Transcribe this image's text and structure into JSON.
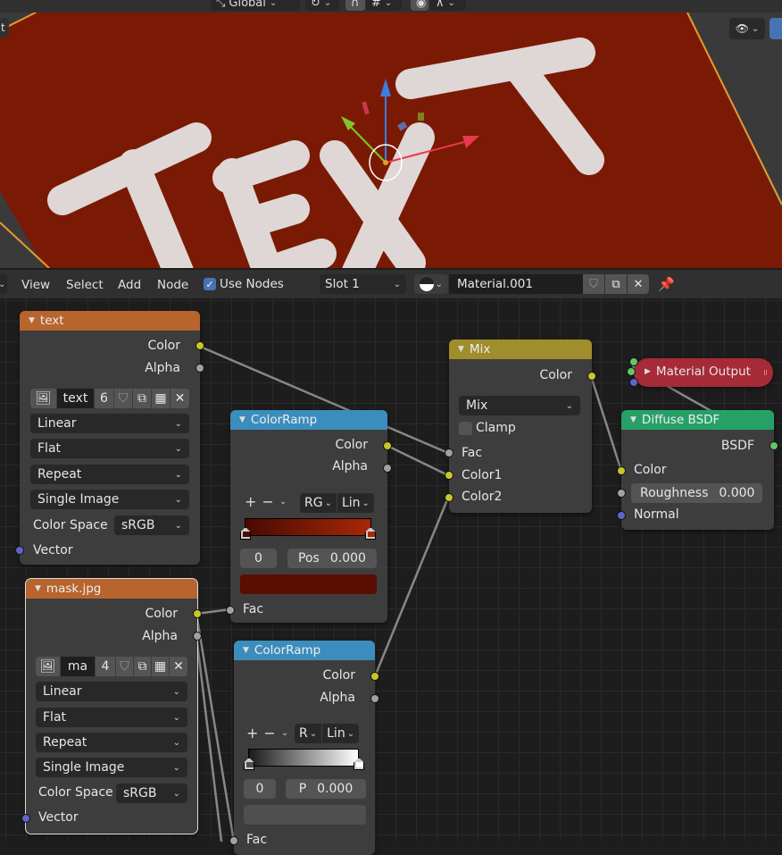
{
  "viewport": {
    "header": {
      "orientation": "Global",
      "orientation_icon": "transform-orientation-icon",
      "pivot_icon": "pivot-point-icon",
      "snap_icon": "snap-magnet-icon",
      "snap_target_icon": "snap-increment-icon",
      "proportional_icon": "proportional-edit-icon",
      "falloff_icon": "falloff-curve-icon"
    },
    "left_tab": "t",
    "scene_text": "TEXT",
    "visibility_icon": "eye-selectability-icon",
    "gizmo_icon": "gizmo-toggle-icon",
    "colors": {
      "plane": "#7a1a05",
      "plane_edge": "#e89a2c",
      "text": "#e8e8e8"
    }
  },
  "node_header": {
    "menus": [
      "View",
      "Select",
      "Add",
      "Node"
    ],
    "use_nodes_label": "Use Nodes",
    "use_nodes_checked": true,
    "slot": "Slot 1",
    "material_name": "Material.001",
    "pin_icon": "pin-icon"
  },
  "nodes": {
    "image_text": {
      "title": "text",
      "outputs": [
        "Color",
        "Alpha"
      ],
      "image_name": "text",
      "users": "6",
      "interpolation": "Linear",
      "projection": "Flat",
      "extension": "Repeat",
      "source": "Single Image",
      "color_space_label": "Color Space",
      "color_space": "sRGB",
      "input": "Vector"
    },
    "image_mask": {
      "title": "mask.jpg",
      "outputs": [
        "Color",
        "Alpha"
      ],
      "image_name": "ma",
      "users": "4",
      "interpolation": "Linear",
      "projection": "Flat",
      "extension": "Repeat",
      "source": "Single Image",
      "color_space_label": "Color Space",
      "color_space": "sRGB",
      "input": "Vector"
    },
    "colorramp_1": {
      "title": "ColorRamp",
      "outputs": [
        "Color",
        "Alpha"
      ],
      "color_mode": "RG",
      "interpolation": "Lin",
      "stop_index": "0",
      "pos_label": "Pos",
      "pos_value": "0.000",
      "input": "Fac",
      "stop_color": "#5a0d02",
      "ramp_start": "#4a0a02",
      "ramp_end": "#a82806"
    },
    "colorramp_2": {
      "title": "ColorRamp",
      "outputs": [
        "Color",
        "Alpha"
      ],
      "color_mode": "R",
      "interpolation": "Lin",
      "stop_index": "0",
      "pos_label": "P",
      "pos_value": "0.000",
      "input": "Fac",
      "stop_color": "#4f4f4f",
      "ramp_start": "#1a1a1a",
      "ramp_end": "#ffffff"
    },
    "mix": {
      "title": "Mix",
      "output": "Color",
      "blend_mode": "Mix",
      "clamp_label": "Clamp",
      "clamp_checked": false,
      "inputs": [
        "Fac",
        "Color1",
        "Color2"
      ]
    },
    "material_output": {
      "title": "Material Output"
    },
    "diffuse": {
      "title": "Diffuse BSDF",
      "output": "BSDF",
      "color_label": "Color",
      "roughness_label": "Roughness",
      "roughness_value": "0.000",
      "normal_label": "Normal"
    }
  },
  "colors": {
    "texture_header": "#b8642d",
    "converter_header": "#3b8dbd",
    "color_header": "#a08d2b",
    "shader_header": "#27a068",
    "output_header": "#a62a37"
  }
}
